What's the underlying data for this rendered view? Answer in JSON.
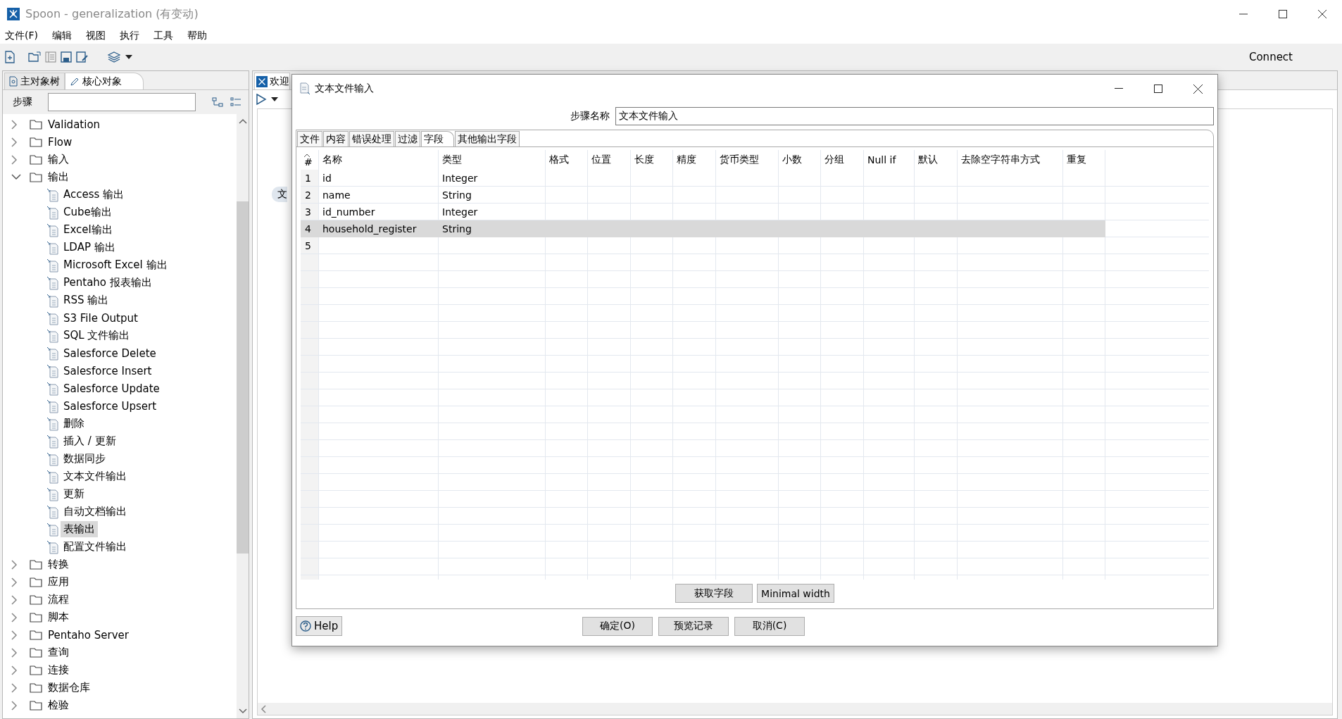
{
  "window": {
    "title": "Spoon - generalization (有变动)"
  },
  "menu": [
    "文件(F)",
    "编辑",
    "视图",
    "执行",
    "工具",
    "帮助"
  ],
  "toolbar": {
    "connect": "Connect"
  },
  "left_panel": {
    "tabs": [
      {
        "label": "主对象树",
        "selected": false
      },
      {
        "label": "核心对象",
        "selected": true
      }
    ],
    "search_label": "步骤",
    "tree": [
      {
        "kind": "folder",
        "label": "Validation",
        "expanded": false,
        "selected": false
      },
      {
        "kind": "folder",
        "label": "Flow",
        "expanded": false,
        "selected": false
      },
      {
        "kind": "folder",
        "label": "输入",
        "expanded": false,
        "selected": false
      },
      {
        "kind": "folder",
        "label": "输出",
        "expanded": true,
        "selected": false,
        "children": [
          {
            "kind": "step",
            "label": "Access 输出",
            "selected": false
          },
          {
            "kind": "step",
            "label": "Cube输出",
            "selected": false
          },
          {
            "kind": "step",
            "label": "Excel输出",
            "selected": false
          },
          {
            "kind": "step",
            "label": "LDAP 输出",
            "selected": false
          },
          {
            "kind": "step",
            "label": "Microsoft Excel 输出",
            "selected": false
          },
          {
            "kind": "step",
            "label": "Pentaho 报表输出",
            "selected": false
          },
          {
            "kind": "step",
            "label": "RSS 输出",
            "selected": false
          },
          {
            "kind": "step",
            "label": "S3 File Output",
            "selected": false
          },
          {
            "kind": "step",
            "label": "SQL 文件输出",
            "selected": false
          },
          {
            "kind": "step",
            "label": "Salesforce Delete",
            "selected": false
          },
          {
            "kind": "step",
            "label": "Salesforce Insert",
            "selected": false
          },
          {
            "kind": "step",
            "label": "Salesforce Update",
            "selected": false
          },
          {
            "kind": "step",
            "label": "Salesforce Upsert",
            "selected": false
          },
          {
            "kind": "step",
            "label": "删除",
            "selected": false
          },
          {
            "kind": "step",
            "label": "插入 / 更新",
            "selected": false
          },
          {
            "kind": "step",
            "label": "数据同步",
            "selected": false
          },
          {
            "kind": "step",
            "label": "文本文件输出",
            "selected": false
          },
          {
            "kind": "step",
            "label": "更新",
            "selected": false
          },
          {
            "kind": "step",
            "label": "自动文档输出",
            "selected": false
          },
          {
            "kind": "step",
            "label": "表输出",
            "selected": true
          },
          {
            "kind": "step",
            "label": "配置文件输出",
            "selected": false
          }
        ]
      },
      {
        "kind": "folder",
        "label": "转换",
        "expanded": false,
        "selected": false
      },
      {
        "kind": "folder",
        "label": "应用",
        "expanded": false,
        "selected": false
      },
      {
        "kind": "folder",
        "label": "流程",
        "expanded": false,
        "selected": false
      },
      {
        "kind": "folder",
        "label": "脚本",
        "expanded": false,
        "selected": false
      },
      {
        "kind": "folder",
        "label": "Pentaho Server",
        "expanded": false,
        "selected": false
      },
      {
        "kind": "folder",
        "label": "查询",
        "expanded": false,
        "selected": false
      },
      {
        "kind": "folder",
        "label": "连接",
        "expanded": false,
        "selected": false
      },
      {
        "kind": "folder",
        "label": "数据仓库",
        "expanded": false,
        "selected": false
      },
      {
        "kind": "folder",
        "label": "检验",
        "expanded": false,
        "selected": false
      }
    ]
  },
  "right_panel": {
    "tab": "欢迎",
    "canvas_node": "文"
  },
  "dialog": {
    "title": "文本文件输入",
    "step_name_label": "步骤名称",
    "step_name": "文本文件输入",
    "tabs": [
      {
        "label": "文件",
        "selected": false
      },
      {
        "label": "内容",
        "selected": false
      },
      {
        "label": "错误处理",
        "selected": false
      },
      {
        "label": "过滤",
        "selected": false
      },
      {
        "label": "字段",
        "selected": true
      },
      {
        "label": "其他输出字段",
        "selected": false
      }
    ],
    "table": {
      "columns": [
        "#",
        "名称",
        "类型",
        "格式",
        "位置",
        "长度",
        "精度",
        "货币类型",
        "小数",
        "分组",
        "Null if",
        "默认",
        "去除空字符串方式",
        "重复"
      ],
      "rows": [
        {
          "index": "1",
          "cells": [
            "id",
            "Integer"
          ],
          "selected": false
        },
        {
          "index": "2",
          "cells": [
            "name",
            "String"
          ],
          "selected": false
        },
        {
          "index": "3",
          "cells": [
            "id_number",
            "Integer"
          ],
          "selected": false
        },
        {
          "index": "4",
          "cells": [
            "household_register",
            "String"
          ],
          "selected": true
        },
        {
          "index": "5",
          "selected": false
        }
      ]
    },
    "table_buttons": [
      "获取字段",
      "Minimal width"
    ],
    "help": "Help",
    "buttons": [
      "确定(O)",
      "预览记录",
      "取消(C)"
    ]
  }
}
